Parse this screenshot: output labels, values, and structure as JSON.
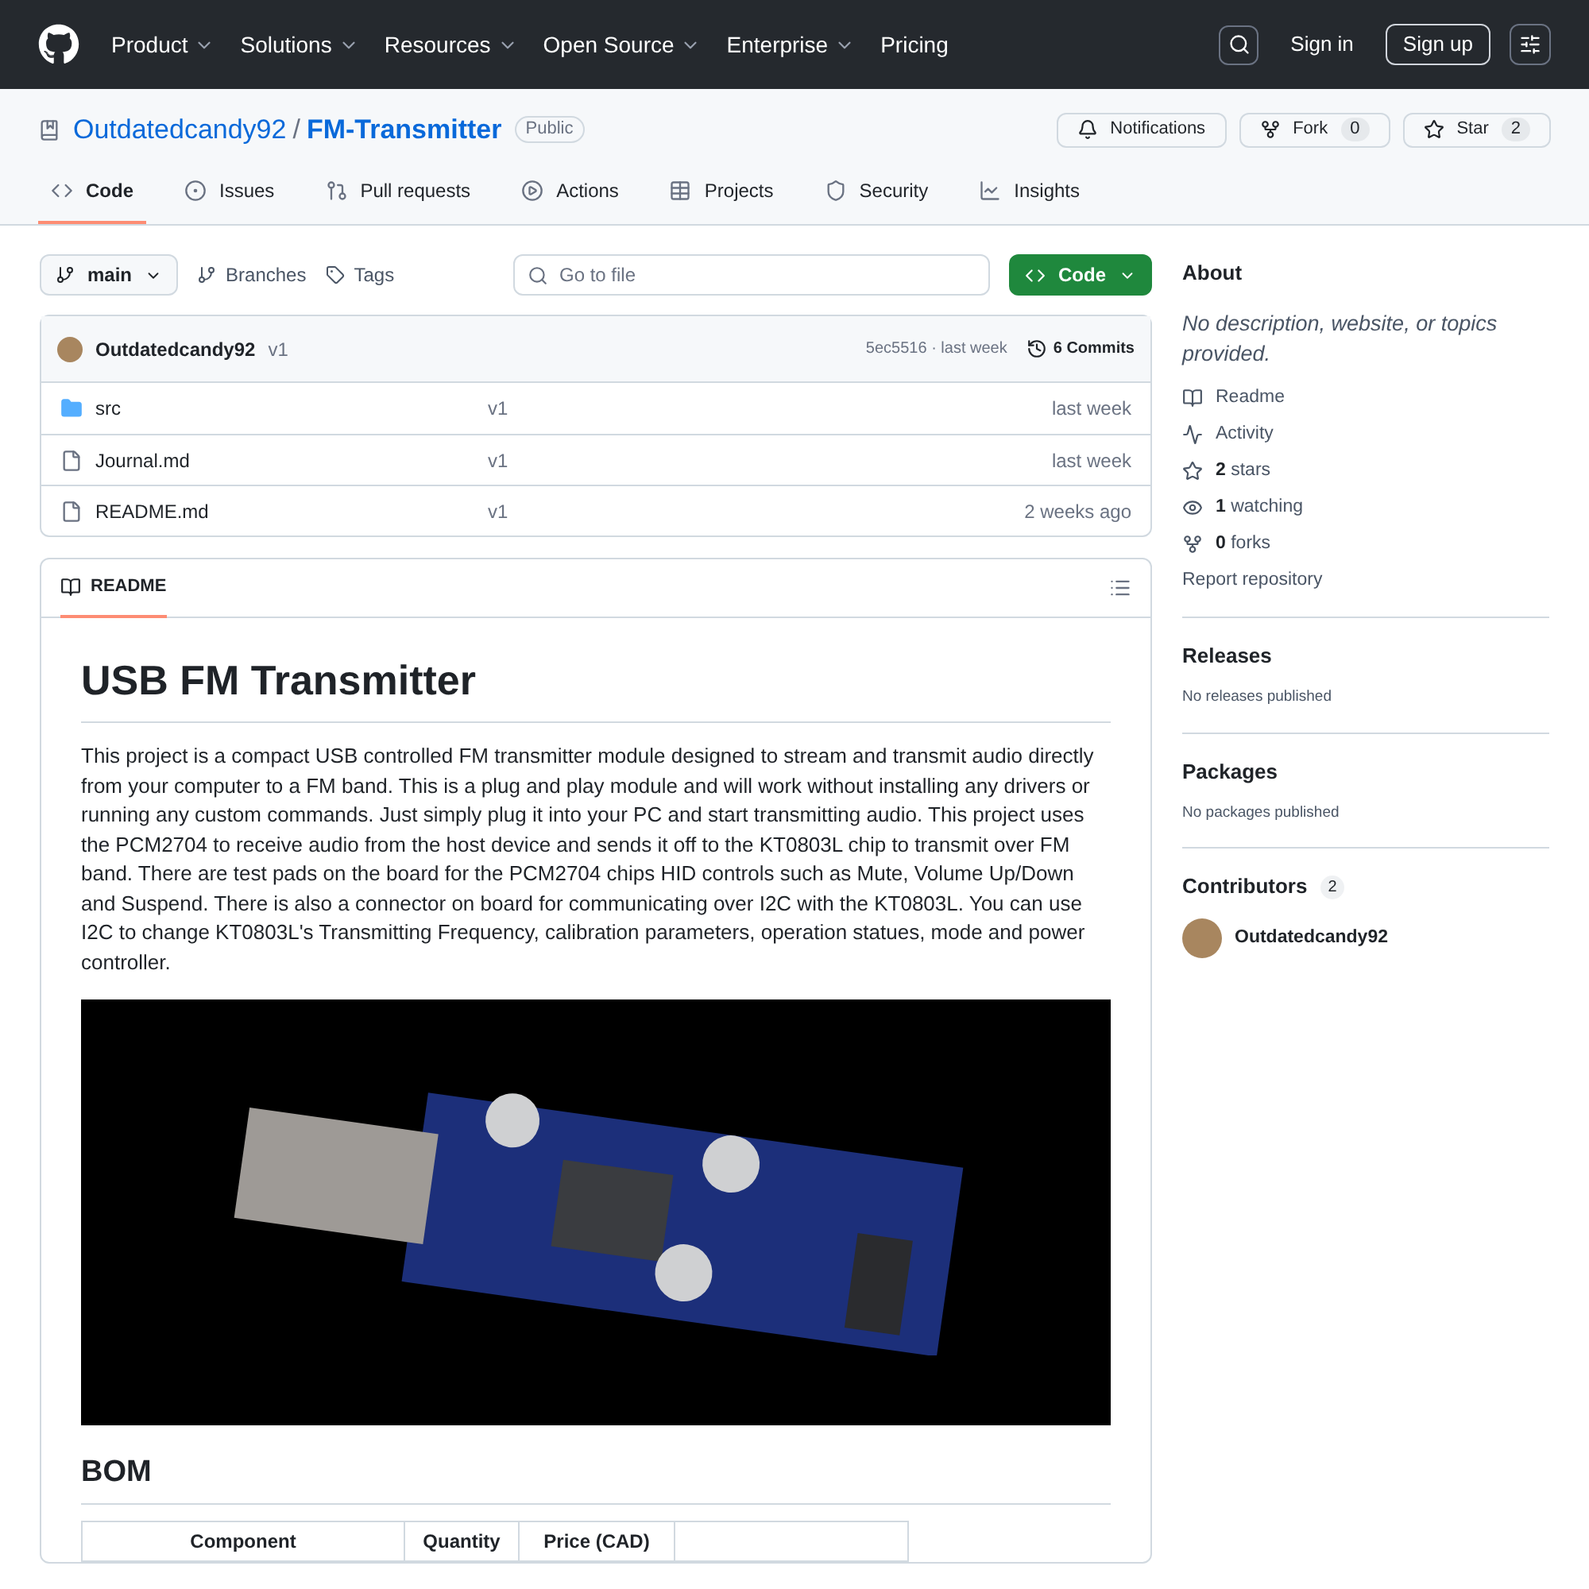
{
  "nav": {
    "items": [
      {
        "label": "Product",
        "dropdown": true
      },
      {
        "label": "Solutions",
        "dropdown": true
      },
      {
        "label": "Resources",
        "dropdown": true
      },
      {
        "label": "Open Source",
        "dropdown": true
      },
      {
        "label": "Enterprise",
        "dropdown": true
      },
      {
        "label": "Pricing",
        "dropdown": false
      }
    ],
    "sign_in": "Sign in",
    "sign_up": "Sign up"
  },
  "repo": {
    "owner": "Outdatedcandy92",
    "separator": "/",
    "name": "FM-Transmitter",
    "visibility": "Public",
    "actions": [
      {
        "kind": "notifications",
        "label": "Notifications"
      },
      {
        "kind": "fork",
        "label": "Fork",
        "count": "0"
      },
      {
        "kind": "star",
        "label": "Star",
        "count": "2"
      }
    ],
    "tabs": [
      {
        "kind": "code",
        "label": "Code",
        "selected": true
      },
      {
        "kind": "issues",
        "label": "Issues",
        "selected": false
      },
      {
        "kind": "pulls",
        "label": "Pull requests",
        "selected": false
      },
      {
        "kind": "actions",
        "label": "Actions",
        "selected": false
      },
      {
        "kind": "projects",
        "label": "Projects",
        "selected": false
      },
      {
        "kind": "security",
        "label": "Security",
        "selected": false
      },
      {
        "kind": "insights",
        "label": "Insights",
        "selected": false
      }
    ]
  },
  "toolbar": {
    "branch": "main",
    "branches": "Branches",
    "tags": "Tags",
    "search_placeholder": "Go to file",
    "code_button": "Code"
  },
  "commit": {
    "author": "Outdatedcandy92",
    "message": "v1",
    "hash_time": "5ec5516 · last week",
    "commits": "6 Commits"
  },
  "files": [
    {
      "kind": "folder",
      "name": "src",
      "message": "v1",
      "time": "last week"
    },
    {
      "kind": "file",
      "name": "Journal.md",
      "message": "v1",
      "time": "last week"
    },
    {
      "kind": "file",
      "name": "README.md",
      "message": "v1",
      "time": "2 weeks ago"
    }
  ],
  "readme": {
    "tab": "README",
    "title": "USB FM Transmitter",
    "paragraph": "This project is a compact USB controlled FM transmitter module designed to stream and transmit audio directly from your computer to a FM band. This is a plug and play module and will work without installing any drivers or running any custom commands. Just simply plug it into your PC and start transmitting audio. This project uses the PCM2704 to receive audio from the host device and sends it off to the KT0803L chip to transmit over FM band. There are test pads on the board for the PCM2704 chips HID controls such as Mute, Volume Up/Down and Suspend. There is also a connector on board for communicating over I2C with the KT0803L. You can use I2C to change KT0803L's Transmitting Frequency, calibration parameters, operation statues, mode and power controller.",
    "bom_heading": "BOM",
    "bom_columns": [
      "Component",
      "Quantity",
      "Price (CAD)"
    ]
  },
  "about": {
    "heading": "About",
    "description": "No description, website, or topics provided.",
    "links": [
      {
        "kind": "readme",
        "label": "Readme"
      },
      {
        "kind": "activity",
        "label": "Activity"
      },
      {
        "kind": "stars",
        "count": "2",
        "label": "stars"
      },
      {
        "kind": "watching",
        "count": "1",
        "label": "watching"
      },
      {
        "kind": "forks",
        "count": "0",
        "label": "forks"
      }
    ],
    "report": "Report repository"
  },
  "releases": {
    "heading": "Releases",
    "text": "No releases published"
  },
  "packages": {
    "heading": "Packages",
    "text": "No packages published"
  },
  "contributors": {
    "heading": "Contributors",
    "count": "2",
    "people": [
      {
        "name": "Outdatedcandy92"
      }
    ]
  }
}
